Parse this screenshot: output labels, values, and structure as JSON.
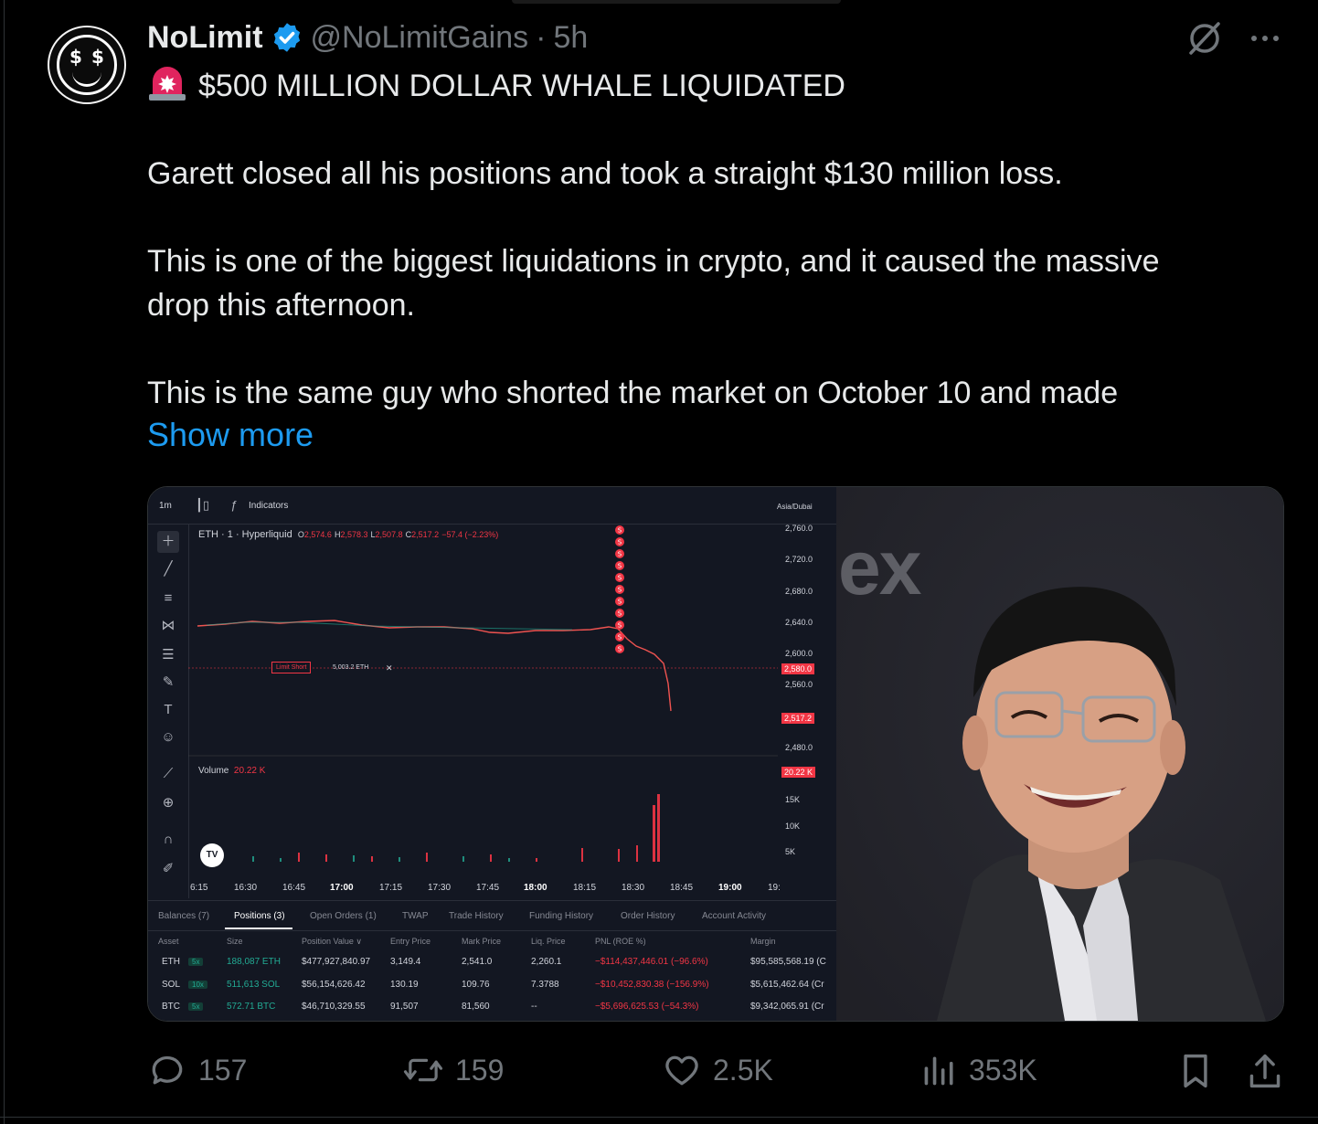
{
  "tweet": {
    "author_name": "NoLimit",
    "handle": "@NoLimitGains",
    "separator": "·",
    "time": "5h",
    "headline": "$500 MILLION DOLLAR WHALE LIQUIDATED",
    "paragraph1": "Garett closed all his positions and took a straight $130 million loss.",
    "paragraph2_line1": "This is one of the biggest liquidations in crypto, and it caused the massive",
    "paragraph2_line2": "drop this afternoon.",
    "paragraph3": "This is the same guy who shorted the market on October 10 and made",
    "show_more": "Show more"
  },
  "chart": {
    "interval": "1m",
    "indicators_label": "Indicators",
    "timezone": "Asia/Dubai",
    "symbol": "ETH · 1 · Hyperliquid",
    "ohlc": {
      "o_label": "O",
      "o": "2,574.6",
      "h_label": "H",
      "h": "2,578.3",
      "l_label": "L",
      "l": "2,507.8",
      "c_label": "C",
      "c": "2,517.2",
      "change": "−57.4 (−2.23%)"
    },
    "price_ticks": [
      "2,760.0",
      "2,720.0",
      "2,680.0",
      "2,640.0",
      "2,600.0",
      "2,560.0",
      "2,480.0"
    ],
    "price_tag_1": "2,580.0",
    "price_tag_2": "2,517.2",
    "volume_label": "Volume",
    "volume_value": "20.22 K",
    "volume_tag": "20.22 K",
    "volume_ticks": [
      "15K",
      "10K",
      "5K"
    ],
    "order_label": "Limit Short",
    "order_size": "5,003.2 ETH",
    "order_close": "✕",
    "logo_text": "TV",
    "time_labels": [
      "6:15",
      "16:30",
      "16:45",
      "17:00",
      "17:15",
      "17:30",
      "17:45",
      "18:00",
      "18:15",
      "18:30",
      "18:45",
      "19:00",
      "19:"
    ],
    "fill_marker": "S",
    "tabs": [
      "Balances (7)",
      "Positions (3)",
      "Open Orders (1)",
      "TWAP",
      "Trade History",
      "Funding History",
      "Order History",
      "Account Activity"
    ],
    "table_headers": [
      "Asset",
      "Size",
      "Position Value ∨",
      "Entry Price",
      "Mark Price",
      "Liq. Price",
      "PNL (ROE %)",
      "Margin"
    ],
    "positions": [
      {
        "asset": "ETH",
        "leverage": "5x",
        "size": "188,087 ETH",
        "value": "$477,927,840.97",
        "entry": "3,149.4",
        "mark": "2,541.0",
        "liq": "2,260.1",
        "pnl": "−$114,437,446.01 (−96.6%)",
        "margin": "$95,585,568.19 (C"
      },
      {
        "asset": "SOL",
        "leverage": "10x",
        "size": "511,613 SOL",
        "value": "$56,154,626.42",
        "entry": "130.19",
        "mark": "109.76",
        "liq": "7.3788",
        "pnl": "−$10,452,830.38 (−156.9%)",
        "margin": "$5,615,462.64 (Cr"
      },
      {
        "asset": "BTC",
        "leverage": "5x",
        "size": "572.71 BTC",
        "value": "$46,710,329.55",
        "entry": "91,507",
        "mark": "81,560",
        "liq": "--",
        "pnl": "−$5,696,625.53 (−54.3%)",
        "margin": "$9,342,065.91 (Cr"
      }
    ]
  },
  "photo": {
    "backdrop_text": "ex"
  },
  "actions": {
    "replies": "157",
    "reposts": "159",
    "likes": "2.5K",
    "views": "353K"
  },
  "colors": {
    "background": "#000000",
    "text": "#e7e9ea",
    "muted": "#71767b",
    "link": "#1d9bf0",
    "verified": "#1d9bf0",
    "chart_bg": "#131722",
    "candle_down": "#f23645",
    "candle_up": "#22ab94"
  }
}
